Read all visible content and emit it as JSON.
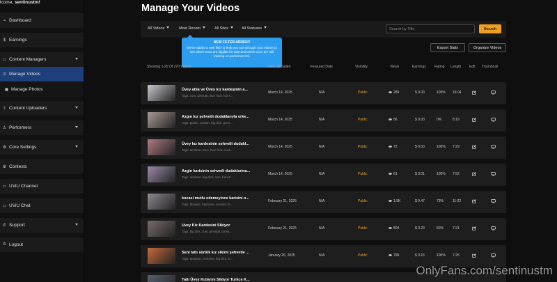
{
  "sidebar": {
    "welcome_prefix": "lcome, ",
    "welcome_user": "sentinustm!",
    "items": [
      {
        "label": "Dashboard",
        "icon": "dashboard-icon",
        "glyph": "⌁"
      },
      {
        "label": "Earnings",
        "icon": "dollar-icon",
        "glyph": "$"
      },
      {
        "label": "Content Managers",
        "icon": "folder-icon",
        "glyph": "▭"
      },
      {
        "label": "Manage Videos",
        "icon": "play-circle-icon",
        "glyph": "⊙"
      },
      {
        "label": "Manage Photos",
        "icon": "image-icon",
        "glyph": "▣"
      },
      {
        "label": "Content Uploaders",
        "icon": "upload-icon",
        "glyph": "⇪"
      },
      {
        "label": "Performers",
        "icon": "user-icon",
        "glyph": "♙"
      },
      {
        "label": "Core Settings",
        "icon": "gear-icon",
        "glyph": "⚙"
      },
      {
        "label": "Contests",
        "icon": "trophy-icon",
        "glyph": "♛"
      },
      {
        "label": "UViU Channel",
        "icon": "tv-icon",
        "glyph": "▭"
      },
      {
        "label": "UViU Chat",
        "icon": "chat-icon",
        "glyph": "▭"
      },
      {
        "label": "Support",
        "icon": "support-icon",
        "glyph": "✆"
      },
      {
        "label": "Logout",
        "icon": "logout-icon",
        "glyph": "⏻"
      }
    ]
  },
  "page": {
    "title": "Manage Your Videos"
  },
  "filters": {
    "videos": "All Videos",
    "sort": "Most Recent",
    "sites": "All Sites",
    "statuses": "All Statuses",
    "search_placeholder": "Search by Title",
    "search_button": "Search"
  },
  "tooltip": {
    "title": "NEW FILTER ADDED!!",
    "body": "We've added a new filter to help you sort through your videos to see which ones are eligible for sale and which ones are still missing co-performer IDs."
  },
  "actions": {
    "export": "Export Stats",
    "organize": "Organize Videos"
  },
  "table": {
    "showing": "Showing 1-20 Of 270 Videos",
    "headers": {
      "uploaded": "Date Uploaded",
      "featured": "Featured Date",
      "visibility": "Visibility",
      "views": "Views",
      "earnings": "Earnings",
      "rating": "Rating",
      "length": "Length",
      "edit": "Edit",
      "thumbnail": "Thumbnail"
    },
    "rows": [
      {
        "title": "Üvey abla ve Üvey kız kardeşinin a...",
        "tags": "Tags: cum, pinvstar, face fuck, hot s...",
        "date": "March 14, 2025",
        "featured": "N/A",
        "visibility": "Public",
        "views": "289",
        "earnings": "$ 0.03",
        "rating": "100%",
        "length": "16:04",
        "thumb_color": "#c7c7cf"
      },
      {
        "title": "Azgın kız şehvetli dudaklarıyla erke...",
        "tags": "Tags: public, russian, big dick, gens...",
        "date": "March 14, 2025",
        "featured": "N/A",
        "visibility": "Public",
        "views": "56",
        "earnings": "$ 0.03",
        "rating": "0%",
        "length": "8:19",
        "thumb_color": "#a89a96"
      },
      {
        "title": "Üvey kız kardesinin sehvetli dudakl...",
        "tags": "Tags: amateur, teen, face fuck, suck...",
        "date": "March 14, 2025",
        "featured": "N/A",
        "visibility": "Public",
        "views": "72",
        "earnings": "$ 0.03",
        "rating": "100%",
        "length": "7:29",
        "thumb_color": "#b07b82"
      },
      {
        "title": "Azgin karisinin sehvetli dudaklarina...",
        "tags": "Tags: amateur, big dick, cum, french...",
        "date": "March 14, 2025",
        "featured": "N/A",
        "visibility": "Public",
        "views": "61",
        "earnings": "$ 0.01",
        "rating": "100%",
        "length": "7:52",
        "thumb_color": "#9b8aa8"
      },
      {
        "title": "kocasi mutlu edemeyince karisini o...",
        "tags": "Tags: blowjob, hardcore, cuckold, bi...",
        "date": "February 21, 2025",
        "featured": "N/A",
        "visibility": "Public",
        "views": "1.9K",
        "earnings": "$ 0.47",
        "rating": "73%",
        "length": "11:22",
        "thumb_color": "#8f8a92"
      },
      {
        "title": "Uvey Kiz Kardesini Sikiyor",
        "tags": "Tags: big dick, cum, pinvstar, turvej...",
        "date": "February 21, 2025",
        "featured": "N/A",
        "visibility": "Public",
        "views": "804",
        "earnings": "$ 0.23",
        "rating": "50%",
        "length": "7:21",
        "thumb_color": "#7a6a6c"
      },
      {
        "title": "Seni tatlı sürtük kız sikimi şehvetle ...",
        "tags": "Tags: amateur, cumshot, big dick, le...",
        "date": "January 26, 2025",
        "featured": "N/A",
        "visibility": "Public",
        "views": "799",
        "earnings": "$ 0.16",
        "rating": "100%",
        "length": "7:25",
        "thumb_color": "#c46a3a"
      },
      {
        "title": "Tatlı Üvey Kızlarını Sikiyor Turkce K...",
        "tags": "",
        "date": "",
        "featured": "",
        "visibility": "",
        "views": "",
        "earnings": "",
        "rating": "",
        "length": "",
        "thumb_color": "#5a6070"
      }
    ]
  },
  "watermark": "OnlyFans.com/sentinustm"
}
